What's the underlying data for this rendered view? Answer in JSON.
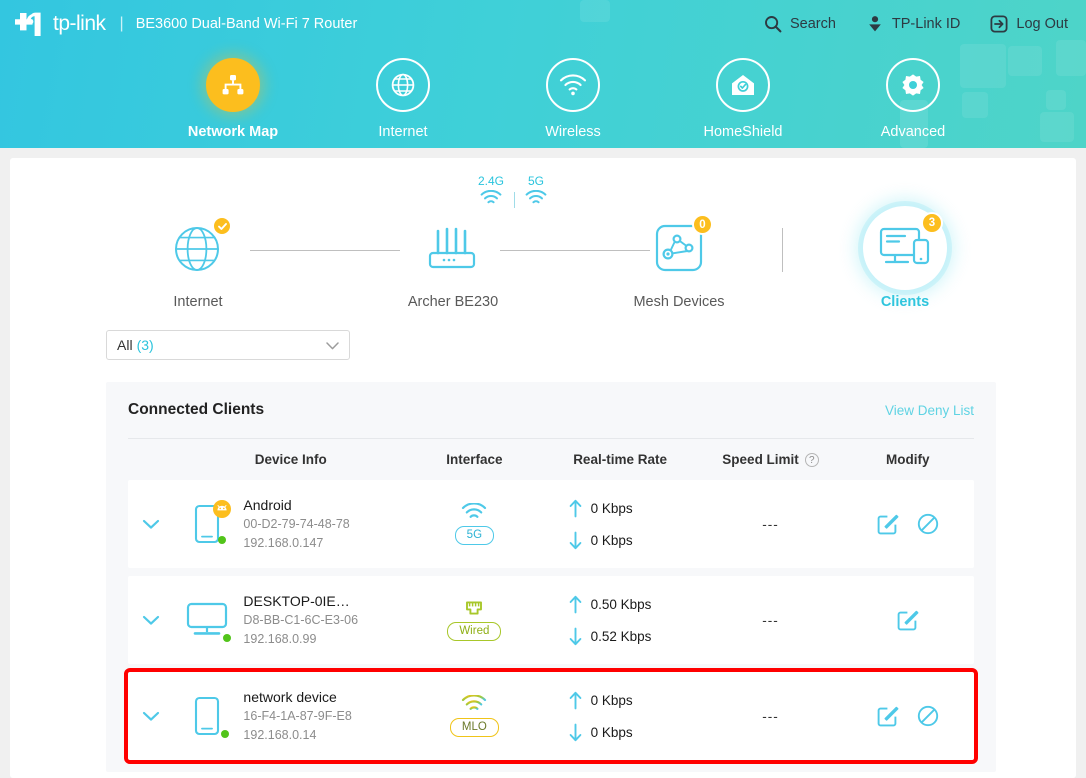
{
  "header": {
    "brand": "tp-link",
    "separator": "|",
    "model": "BE3600 Dual-Band Wi-Fi 7 Router",
    "actions": [
      {
        "label": "Search",
        "icon": "search-icon"
      },
      {
        "label": "TP-Link ID",
        "icon": "tp-link-id-icon"
      },
      {
        "label": "Log Out",
        "icon": "logout-icon"
      }
    ],
    "nav": [
      {
        "label": "Network Map",
        "icon": "network-map-icon",
        "active": true
      },
      {
        "label": "Internet",
        "icon": "globe-icon",
        "active": false
      },
      {
        "label": "Wireless",
        "icon": "wifi-icon",
        "active": false
      },
      {
        "label": "HomeShield",
        "icon": "home-shield-icon",
        "active": false
      },
      {
        "label": "Advanced",
        "icon": "gear-icon",
        "active": false
      }
    ]
  },
  "topology": {
    "internet": {
      "label": "Internet",
      "status": "connected"
    },
    "router": {
      "label": "Archer BE230"
    },
    "bands": {
      "band_24": "2.4G",
      "band_5": "5G"
    },
    "mesh": {
      "label": "Mesh Devices",
      "count": "0"
    },
    "clients": {
      "label": "Clients",
      "count": "3",
      "selected": true
    }
  },
  "filter": {
    "label": "All",
    "count": "(3)"
  },
  "clients_panel": {
    "title": "Connected Clients",
    "deny_link": "View Deny List",
    "columns": {
      "device_info": "Device Info",
      "interface": "Interface",
      "realtime_rate": "Real-time Rate",
      "speed_limit": "Speed Limit",
      "modify": "Modify",
      "help": "?"
    },
    "rows": [
      {
        "name": "Android",
        "mac": "00-D2-79-74-48-78",
        "ip": "192.168.0.147",
        "device_icon": "phone-icon",
        "os_badge": "android-icon",
        "interface": "5G",
        "interface_type": "wifi",
        "upload": "0 Kbps",
        "download": "0 Kbps",
        "speed_limit": "---",
        "actions": [
          "edit-icon",
          "block-icon"
        ],
        "highlighted": false
      },
      {
        "name": "DESKTOP-0IE…",
        "mac": "D8-BB-C1-6C-E3-06",
        "ip": "192.168.0.99",
        "device_icon": "desktop-icon",
        "os_badge": "",
        "interface": "Wired",
        "interface_type": "wired",
        "upload": "0.50 Kbps",
        "download": "0.52 Kbps",
        "speed_limit": "---",
        "actions": [
          "edit-icon"
        ],
        "highlighted": false
      },
      {
        "name": "network device",
        "mac": "16-F4-1A-87-9F-E8",
        "ip": "192.168.0.14",
        "device_icon": "phone-icon",
        "os_badge": "",
        "interface": "MLO",
        "interface_type": "mlo",
        "upload": "0 Kbps",
        "download": "0 Kbps",
        "speed_limit": "---",
        "actions": [
          "edit-icon",
          "block-icon"
        ],
        "highlighted": true
      }
    ]
  },
  "colors": {
    "brand_teal": "#2bc4dd",
    "accent_yellow": "#fcbe1e",
    "wired_green": "#8faf16",
    "highlight_red": "#ff0000",
    "online_green": "#52c41a"
  }
}
